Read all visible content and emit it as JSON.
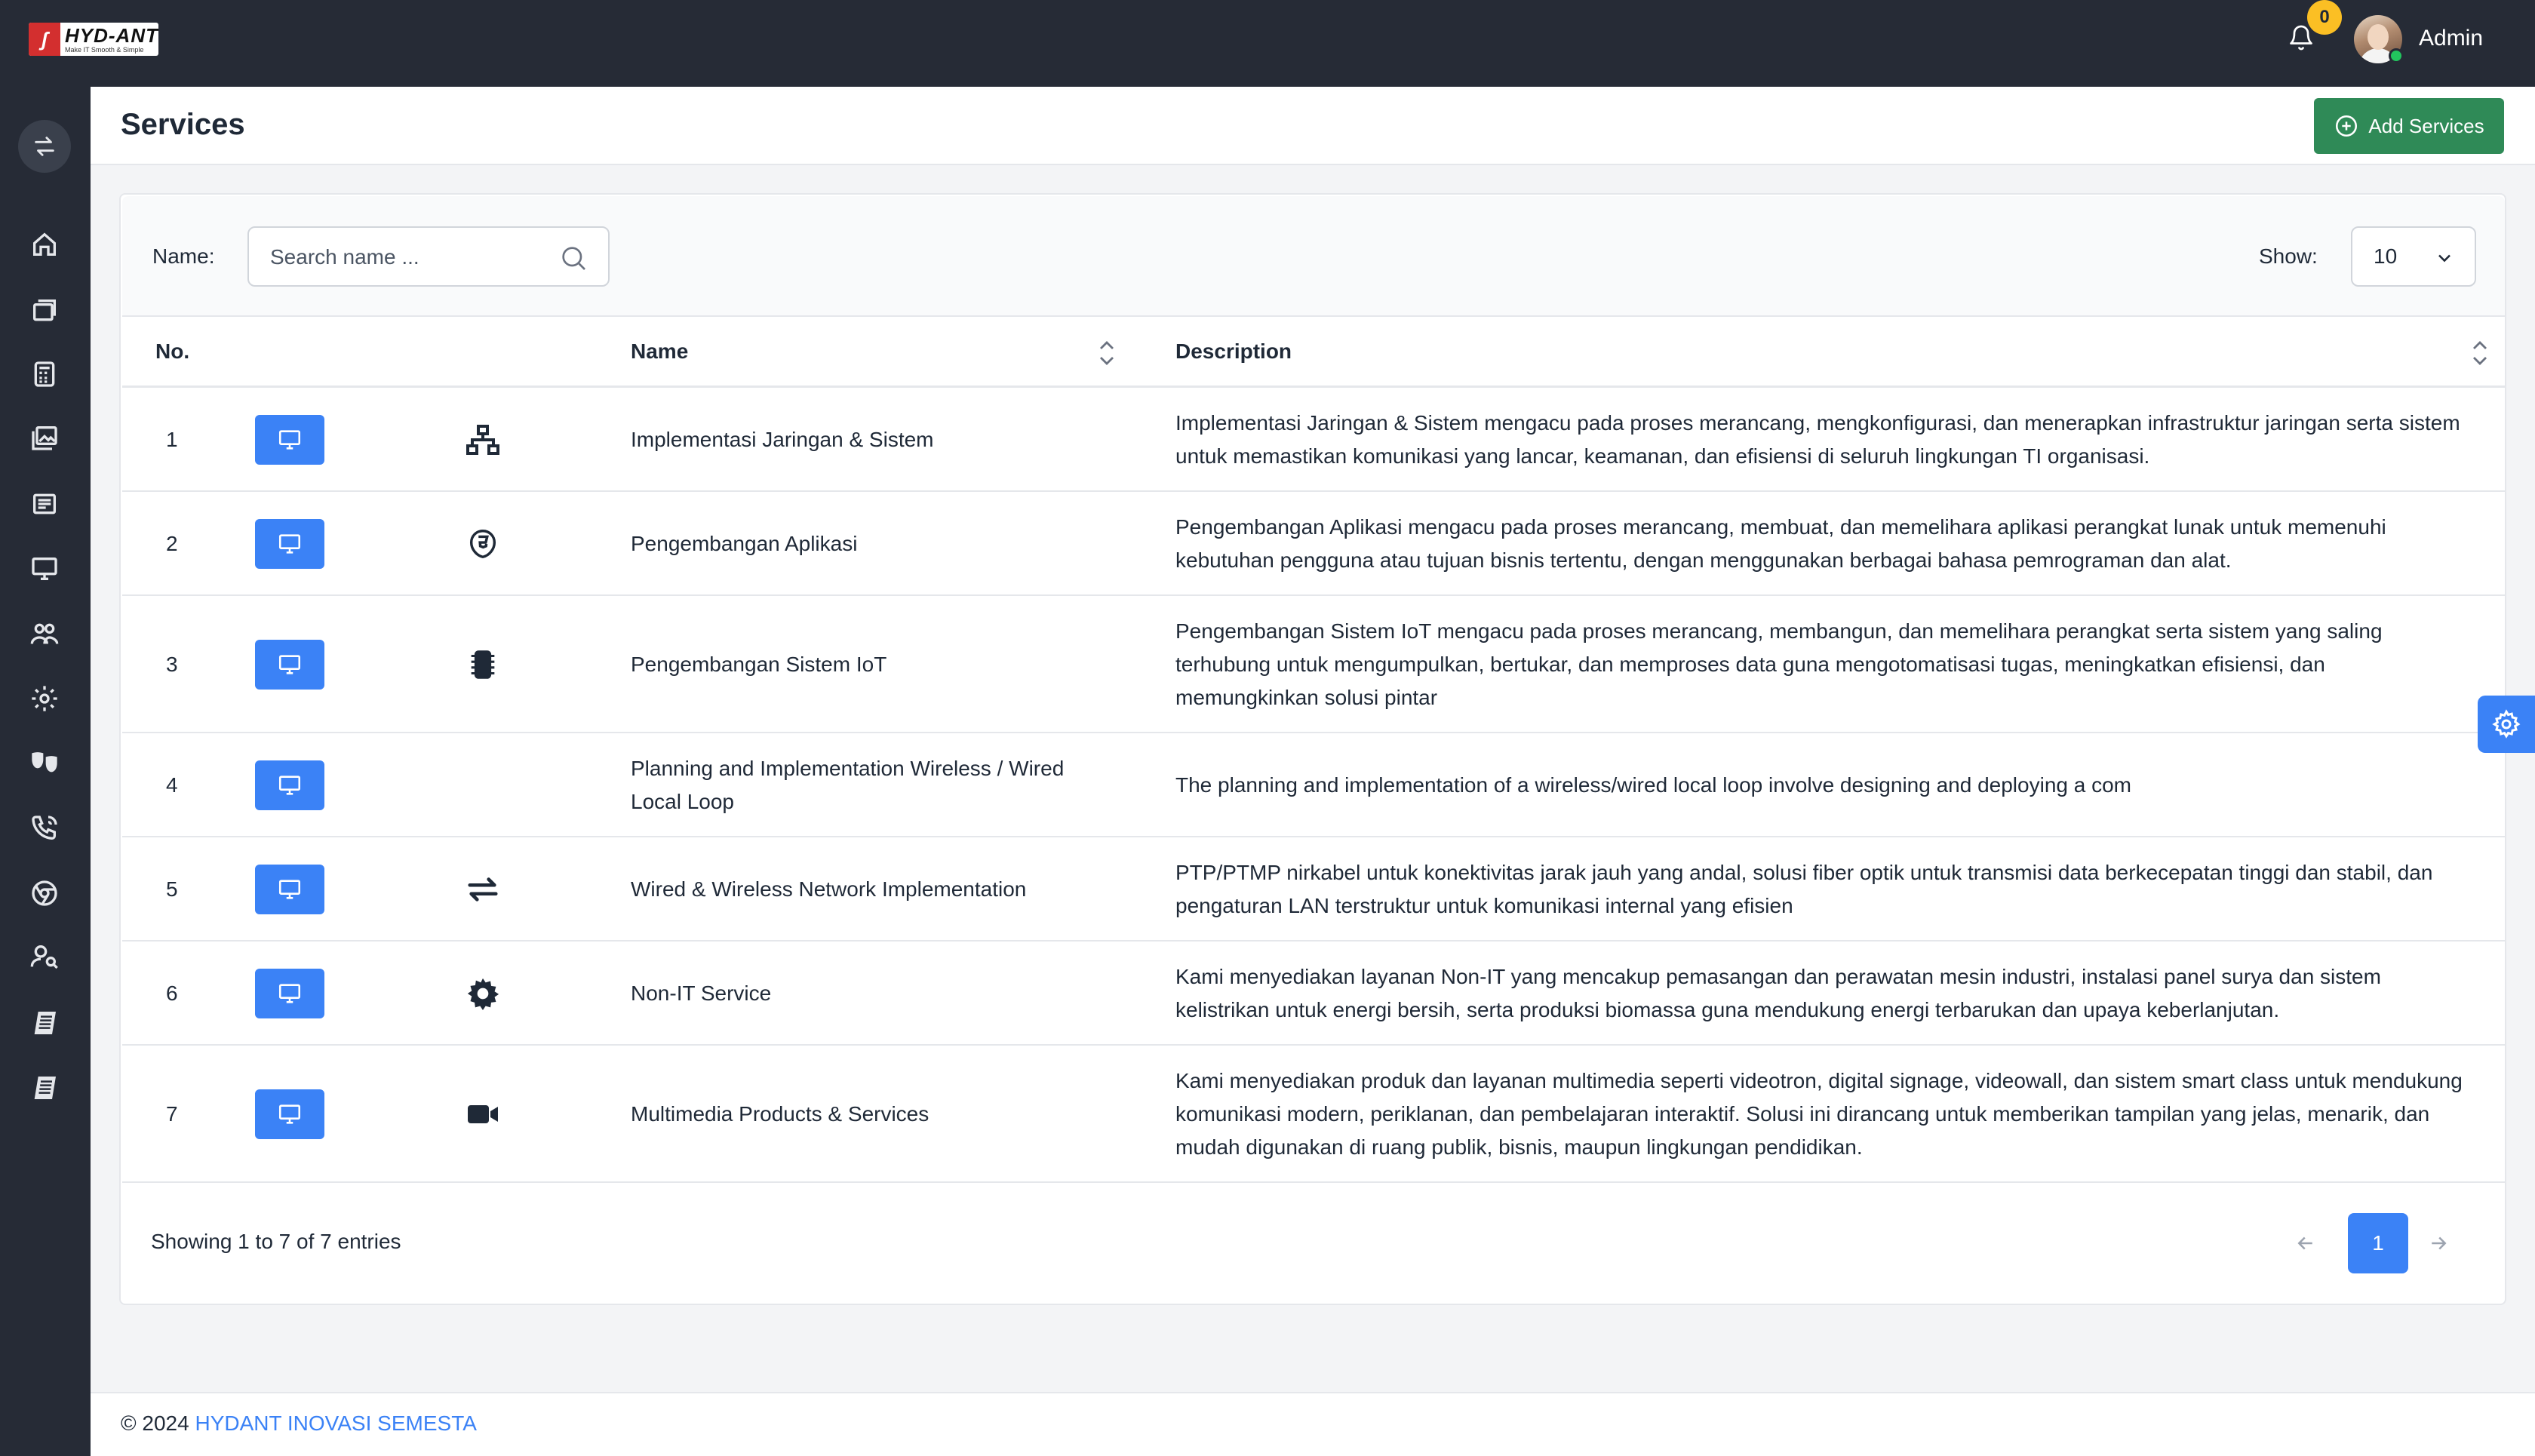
{
  "header": {
    "logo_brand": "HYD-ANT",
    "logo_tagline": "Make IT Smooth & Simple",
    "notification_count": "0",
    "user_name": "Admin"
  },
  "page": {
    "title": "Services",
    "add_button_label": "Add Services"
  },
  "filters": {
    "name_label": "Name:",
    "search_placeholder": "Search name ...",
    "show_label": "Show:",
    "show_value": "10"
  },
  "table": {
    "columns": [
      "No.",
      "Name",
      "Description"
    ],
    "rows": [
      {
        "no": "1",
        "icon": "network-icon",
        "name": "Implementasi Jaringan & Sistem",
        "description": "Implementasi Jaringan & Sistem mengacu pada proses merancang, mengkonfigurasi, dan menerapkan infrastruktur jaringan serta sistem untuk memastikan komunikasi yang lancar, keamanan, dan efisiensi di seluruh lingkungan TI organisasi."
      },
      {
        "no": "2",
        "icon": "html5-icon",
        "name": "Pengembangan Aplikasi",
        "description": "Pengembangan Aplikasi mengacu pada proses merancang, membuat, dan memelihara aplikasi perangkat lunak untuk memenuhi kebutuhan pengguna atau tujuan bisnis tertentu, dengan menggunakan berbagai bahasa pemrograman dan alat."
      },
      {
        "no": "3",
        "icon": "chip-icon",
        "name": "Pengembangan Sistem IoT",
        "description": "Pengembangan Sistem IoT mengacu pada proses merancang, membangun, dan memelihara perangkat serta sistem yang saling terhubung untuk mengumpulkan, bertukar, dan memproses data guna mengotomatisasi tugas, meningkatkan efisiensi, dan memungkinkan solusi pintar"
      },
      {
        "no": "4",
        "icon": "",
        "name": "Planning and Implementation Wireless / Wired Local Loop",
        "description": "The planning and implementation of a wireless/wired local loop involve designing and deploying a com"
      },
      {
        "no": "5",
        "icon": "exchange-icon",
        "name": "Wired & Wireless Network Implementation",
        "description": "PTP/PTMP nirkabel untuk konektivitas jarak jauh yang andal, solusi fiber optik untuk transmisi data berkecepatan tinggi dan stabil, dan pengaturan LAN terstruktur untuk komunikasi internal yang efisien"
      },
      {
        "no": "6",
        "icon": "cog-icon",
        "name": "Non-IT Service",
        "description": "Kami menyediakan layanan Non-IT yang mencakup pemasangan dan perawatan mesin industri, instalasi panel surya dan sistem kelistrikan untuk energi bersih, serta produksi biomassa guna mendukung energi terbarukan dan upaya keberlanjutan."
      },
      {
        "no": "7",
        "icon": "video-icon",
        "name": "Multimedia Products & Services",
        "description": "Kami menyediakan produk dan layanan multimedia seperti videotron, digital signage, videowall, dan sistem smart class untuk mendukung komunikasi modern, periklanan, dan pembelajaran interaktif. Solusi ini dirancang untuk memberikan tampilan yang jelas, menarik, dan mudah digunakan di ruang publik, bisnis, maupun lingkungan pendidikan."
      }
    ]
  },
  "pagination": {
    "summary": "Showing 1 to 7 of 7 entries",
    "current_page": "1"
  },
  "footer": {
    "copyright": "© 2024 ",
    "company": "HYDANT INOVASI SEMESTA"
  },
  "colors": {
    "topbar": "#262b36",
    "primary": "#3b82f6",
    "success": "#2f8a57",
    "badge": "#fbbf24"
  }
}
